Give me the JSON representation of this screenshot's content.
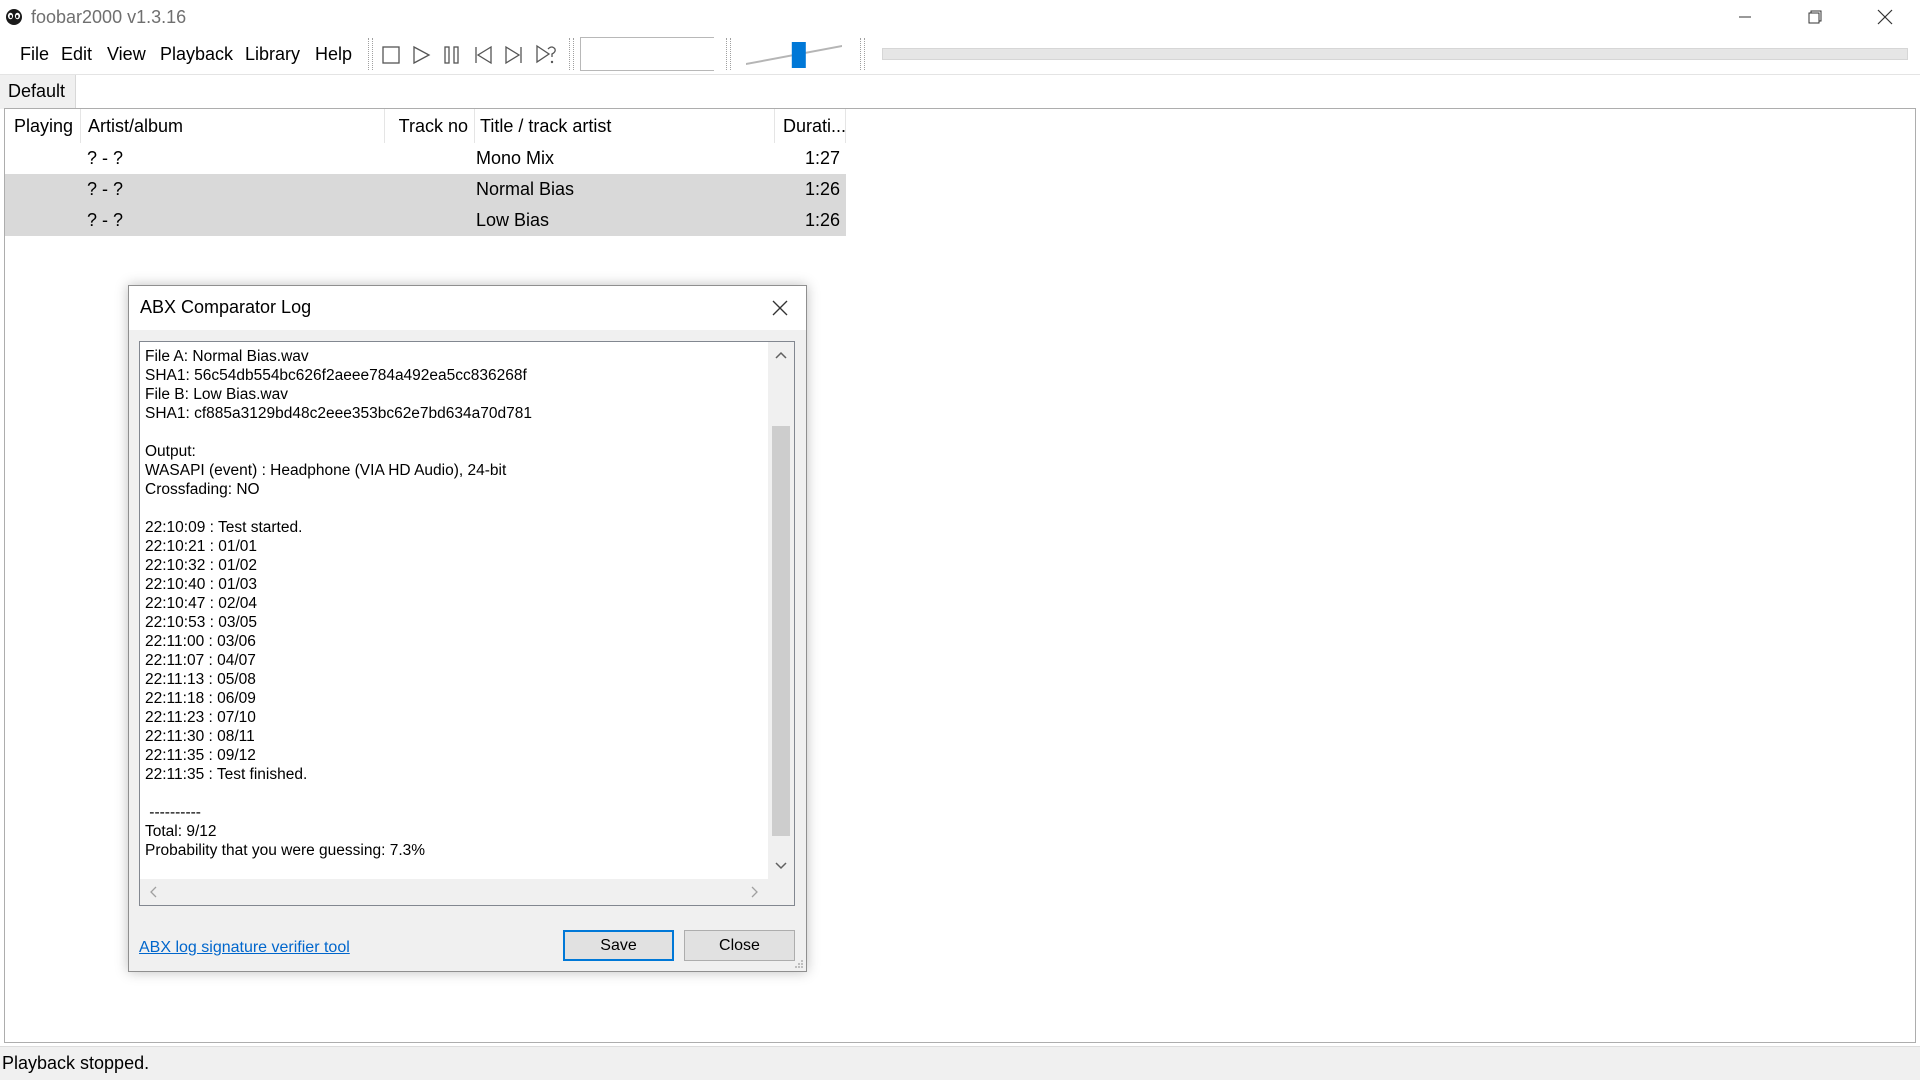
{
  "window": {
    "title": "foobar2000 v1.3.16"
  },
  "menu": [
    "File",
    "Edit",
    "View",
    "Playback",
    "Library",
    "Help"
  ],
  "toolbar": {
    "buttons": [
      "stop-icon",
      "play-icon",
      "pause-icon",
      "previous-icon",
      "next-icon",
      "random-icon"
    ],
    "volume_level_percent": 55,
    "seek_position_percent": 0
  },
  "tabs": [
    "Default"
  ],
  "playlist": {
    "columns": [
      "Playing",
      "Artist/album",
      "Track no",
      "Title / track artist",
      "Durati..."
    ],
    "rows": [
      {
        "playing": "",
        "artist_album": "? - ?",
        "track_no": "",
        "title": "Mono Mix",
        "duration": "1:27",
        "selected": false
      },
      {
        "playing": "",
        "artist_album": "? - ?",
        "track_no": "",
        "title": "Normal Bias",
        "duration": "1:26",
        "selected": true
      },
      {
        "playing": "",
        "artist_album": "? - ?",
        "track_no": "",
        "title": "Low Bias",
        "duration": "1:26",
        "selected": true
      }
    ]
  },
  "status": {
    "text": "Playback stopped."
  },
  "dialog": {
    "title": "ABX Comparator Log",
    "log_lines": [
      "File A: Normal Bias.wav",
      "SHA1: 56c54db554bc626f2aeee784a492ea5cc836268f",
      "File B: Low Bias.wav",
      "SHA1: cf885a3129bd48c2eee353bc62e7bd634a70d781",
      "",
      "Output:",
      "WASAPI (event) : Headphone (VIA HD Audio), 24-bit",
      "Crossfading: NO",
      "",
      "22:10:09 : Test started.",
      "22:10:21 : 01/01",
      "22:10:32 : 01/02",
      "22:10:40 : 01/03",
      "22:10:47 : 02/04",
      "22:10:53 : 03/05",
      "22:11:00 : 03/06",
      "22:11:07 : 04/07",
      "22:11:13 : 05/08",
      "22:11:18 : 06/09",
      "22:11:23 : 07/10",
      "22:11:30 : 08/11",
      "22:11:35 : 09/12",
      "22:11:35 : Test finished.",
      "",
      " ----------",
      "Total: 9/12",
      "Probability that you were guessing: 7.3%"
    ],
    "link_text": "ABX log signature verifier tool",
    "save_label": "Save",
    "close_label": "Close"
  },
  "colors": {
    "selection": "#d9d9d9",
    "link": "#0066cc",
    "focus_border": "#0078d7",
    "volume_thumb": "#0078d7"
  }
}
